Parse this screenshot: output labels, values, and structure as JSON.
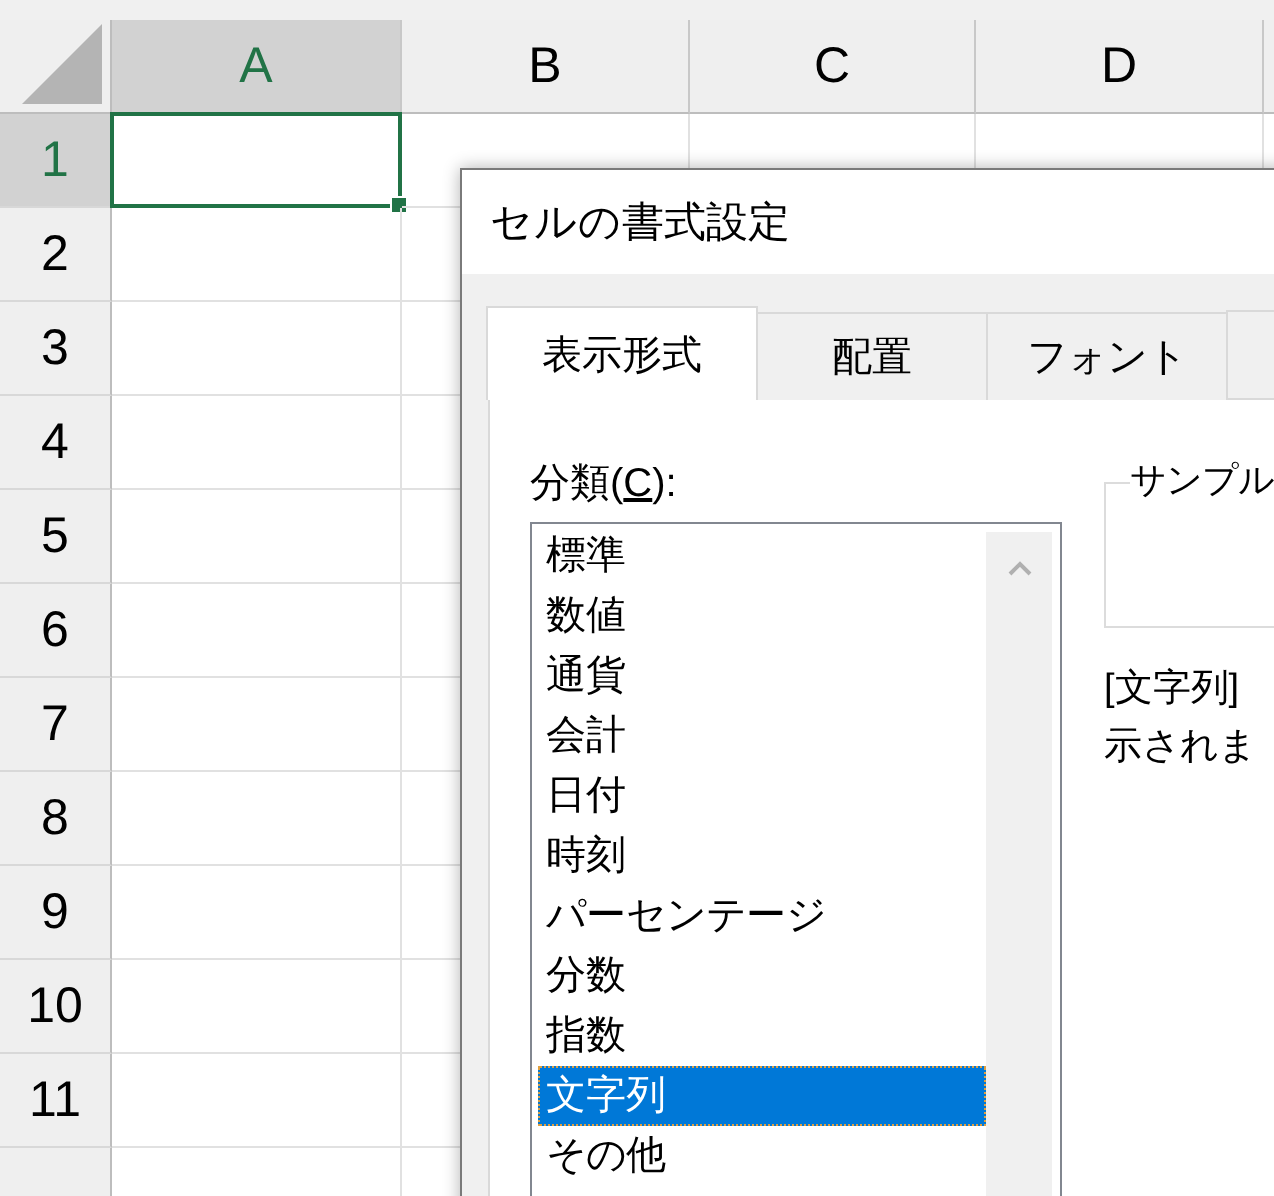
{
  "sheet": {
    "columns": [
      {
        "label": "A",
        "selected": true
      },
      {
        "label": "B",
        "selected": false
      },
      {
        "label": "C",
        "selected": false
      },
      {
        "label": "D",
        "selected": false
      }
    ],
    "rows": [
      {
        "label": "1",
        "selected": true
      },
      {
        "label": "2",
        "selected": false
      },
      {
        "label": "3",
        "selected": false
      },
      {
        "label": "4",
        "selected": false
      },
      {
        "label": "5",
        "selected": false
      },
      {
        "label": "6",
        "selected": false
      },
      {
        "label": "7",
        "selected": false
      },
      {
        "label": "8",
        "selected": false
      },
      {
        "label": "9",
        "selected": false
      },
      {
        "label": "10",
        "selected": false
      },
      {
        "label": "11",
        "selected": false
      }
    ]
  },
  "dialog": {
    "title": "セルの書式設定",
    "tabs": [
      {
        "label": "表示形式",
        "selected": true
      },
      {
        "label": "配置",
        "selected": false
      },
      {
        "label": "フォント",
        "selected": false
      }
    ],
    "category_label": {
      "before": "分類(",
      "access_key": "C",
      "after": "):"
    },
    "categories": [
      {
        "label": "標準",
        "selected": false
      },
      {
        "label": "数値",
        "selected": false
      },
      {
        "label": "通貨",
        "selected": false
      },
      {
        "label": "会計",
        "selected": false
      },
      {
        "label": "日付",
        "selected": false
      },
      {
        "label": "時刻",
        "selected": false
      },
      {
        "label": "パーセンテージ",
        "selected": false
      },
      {
        "label": "分数",
        "selected": false
      },
      {
        "label": "指数",
        "selected": false
      },
      {
        "label": "文字列",
        "selected": true
      },
      {
        "label": "その他",
        "selected": false
      }
    ],
    "sample_label": "サンプル",
    "description": [
      "[文字列]",
      "示されま"
    ]
  }
}
